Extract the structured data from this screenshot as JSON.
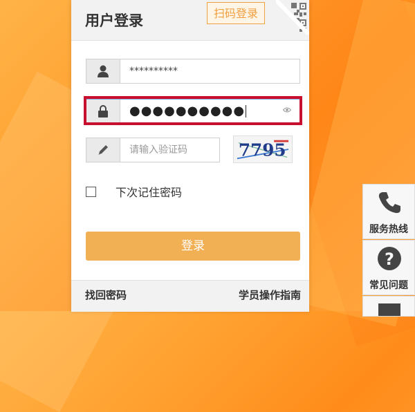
{
  "login": {
    "title": "用户登录",
    "qr_button": "扫码登录",
    "username_value": "**********",
    "password_value": "●●●●●●●●●●",
    "captcha_placeholder": "请输入验证码",
    "captcha_code": "7795",
    "remember_label": "下次记住密码",
    "submit_label": "登录"
  },
  "footer": {
    "recover_password": "找回密码",
    "student_guide": "学员操作指南"
  },
  "side": {
    "hotline": "服务热线",
    "faq": "常见问题"
  },
  "colors": {
    "accent": "#f2b055",
    "qr_border": "#f0a040",
    "highlight": "#c8102e"
  },
  "icons": [
    "user-icon",
    "lock-icon",
    "eye-icon",
    "pencil-icon",
    "qr-code-icon",
    "phone-icon",
    "question-icon",
    "more-icon"
  ]
}
